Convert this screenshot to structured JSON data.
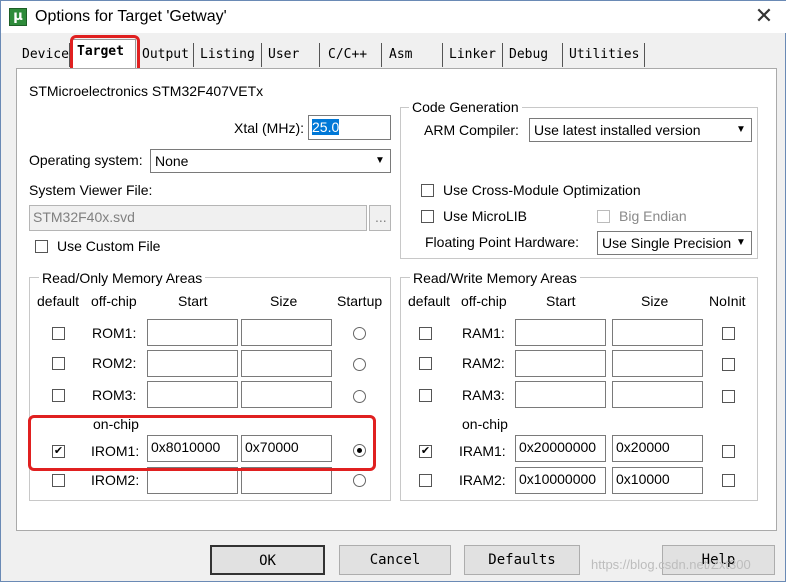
{
  "window": {
    "title": "Options for Target 'Getway'",
    "close_glyph": "✕"
  },
  "tabs": [
    "Device",
    "Target",
    "Output",
    "Listing",
    "User",
    "C/C++",
    "Asm",
    "Linker",
    "Debug",
    "Utilities"
  ],
  "device": {
    "name": "STMicroelectronics STM32F407VETx"
  },
  "xtal": {
    "label": "Xtal (MHz):",
    "value": "25.0"
  },
  "os": {
    "label": "Operating system:",
    "value": "None"
  },
  "svd": {
    "label": "System Viewer File:",
    "value": "STM32F40x.svd",
    "browse": "..."
  },
  "custom_file": {
    "label": "Use Custom File",
    "checked": false
  },
  "codegen": {
    "title": "Code Generation",
    "compiler_label": "ARM Compiler:",
    "compiler_value": "Use latest installed version",
    "cross_module": "Use Cross-Module Optimization",
    "microlib": "Use MicroLIB",
    "big_endian": "Big Endian",
    "fph_label": "Floating Point Hardware:",
    "fph_value": "Use Single Precision"
  },
  "ro": {
    "title": "Read/Only Memory Areas",
    "headers": {
      "default": "default",
      "offchip": "off-chip",
      "start": "Start",
      "size": "Size",
      "startup": "Startup"
    },
    "onchip_label": "on-chip",
    "rows": [
      {
        "name": "ROM1:",
        "start": "",
        "size": "",
        "checked": false,
        "startup": false
      },
      {
        "name": "ROM2:",
        "start": "",
        "size": "",
        "checked": false,
        "startup": false
      },
      {
        "name": "ROM3:",
        "start": "",
        "size": "",
        "checked": false,
        "startup": false
      },
      {
        "name": "IROM1:",
        "start": "0x8010000",
        "size": "0x70000",
        "checked": true,
        "startup": true
      },
      {
        "name": "IROM2:",
        "start": "",
        "size": "",
        "checked": false,
        "startup": false
      }
    ]
  },
  "rw": {
    "title": "Read/Write Memory Areas",
    "headers": {
      "default": "default",
      "offchip": "off-chip",
      "start": "Start",
      "size": "Size",
      "noinit": "NoInit"
    },
    "onchip_label": "on-chip",
    "rows": [
      {
        "name": "RAM1:",
        "start": "",
        "size": "",
        "checked": false,
        "noinit": false
      },
      {
        "name": "RAM2:",
        "start": "",
        "size": "",
        "checked": false,
        "noinit": false
      },
      {
        "name": "RAM3:",
        "start": "",
        "size": "",
        "checked": false,
        "noinit": false
      },
      {
        "name": "IRAM1:",
        "start": "0x20000000",
        "size": "0x20000",
        "checked": true,
        "noinit": false
      },
      {
        "name": "IRAM2:",
        "start": "0x10000000",
        "size": "0x10000",
        "checked": false,
        "noinit": false
      }
    ]
  },
  "buttons": {
    "ok": "OK",
    "cancel": "Cancel",
    "defaults": "Defaults",
    "help": "Help"
  },
  "watermark": "https://blog.csdn.net/Zxt300",
  "colors": {
    "highlight": "#e02020"
  }
}
